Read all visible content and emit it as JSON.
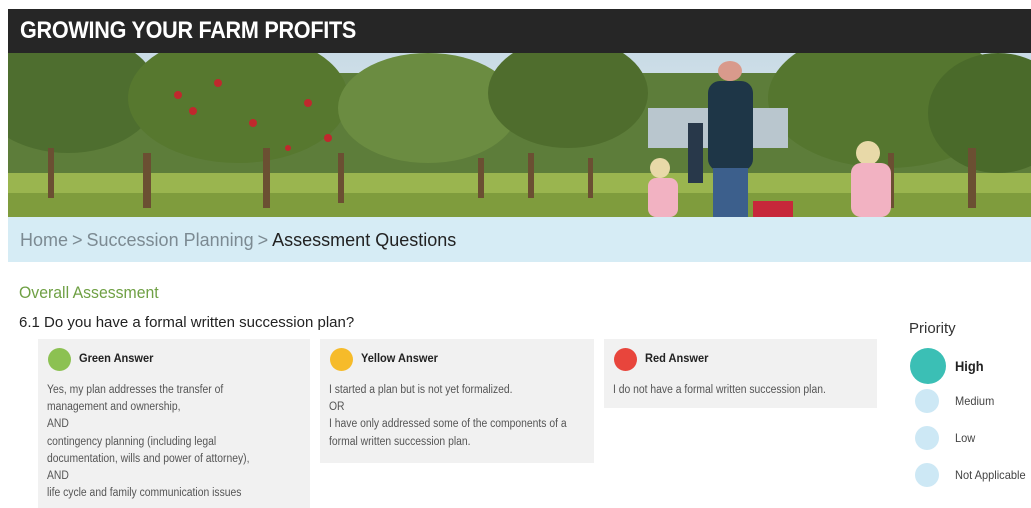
{
  "header": {
    "title": "GROWING YOUR FARM PROFITS"
  },
  "banner": {
    "alt": "apple orchard with family walking"
  },
  "breadcrumb": {
    "home": "Home",
    "sep1": ">",
    "section": "Succession Planning",
    "sep2": ">",
    "current": "Assessment Questions"
  },
  "main": {
    "section_title": "Overall Assessment",
    "question": "6.1 Do you have a formal written succession plan?",
    "answers": [
      {
        "label": "Green Answer",
        "color": "#8cc152",
        "lines": [
          "Yes, my plan addresses the transfer of",
          "management and ownership,",
          "AND",
          "contingency planning (including legal",
          "documentation, wills and power of attorney),",
          "AND",
          "life cycle and family communication issues"
        ]
      },
      {
        "label": "Yellow Answer",
        "color": "#f6bb2a",
        "lines": [
          "I started a plan but is not yet formalized.",
          "OR",
          "I have only addressed some of the components of a",
          "formal written succession plan."
        ]
      },
      {
        "label": "Red Answer",
        "color": "#e8453c",
        "lines": [
          "I do not have a formal written succession plan."
        ]
      }
    ]
  },
  "priority": {
    "title": "Priority",
    "options": [
      {
        "label": "High",
        "selected": true
      },
      {
        "label": "Medium",
        "selected": false
      },
      {
        "label": "Low",
        "selected": false
      },
      {
        "label": "Not Applicable",
        "selected": false
      }
    ],
    "selected_color": "#3bbfb5",
    "unselected_color": "#cde8f5"
  }
}
